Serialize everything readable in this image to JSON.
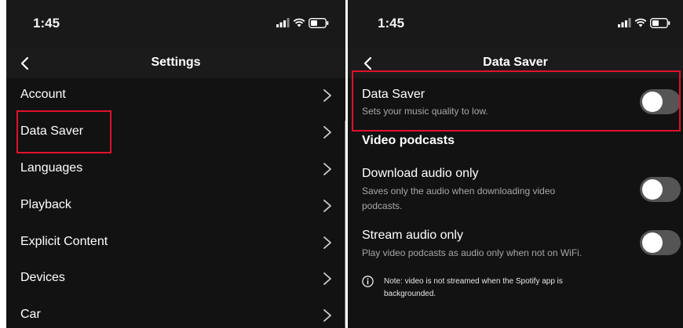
{
  "left_screen": {
    "status_time": "1:45",
    "nav_title": "Settings",
    "menu_items": [
      {
        "label": "Account"
      },
      {
        "label": "Data Saver"
      },
      {
        "label": "Languages"
      },
      {
        "label": "Playback"
      },
      {
        "label": "Explicit Content"
      },
      {
        "label": "Devices"
      },
      {
        "label": "Car"
      }
    ],
    "highlighted_item": "Data Saver"
  },
  "right_screen": {
    "status_time": "1:45",
    "nav_title": "Data Saver",
    "data_saver": {
      "title": "Data Saver",
      "description": "Sets your music quality to low.",
      "enabled": false
    },
    "section_heading": "Video podcasts",
    "download_audio": {
      "title": "Download audio only",
      "description_line1": "Saves only the audio when downloading video",
      "description_line2": "podcasts.",
      "enabled": false
    },
    "stream_audio": {
      "title": "Stream audio only",
      "description": "Play video podcasts as audio only when not on WiFi.",
      "enabled": false
    },
    "note_line1": "Note: video is not streamed when the Spotify app is",
    "note_line2": "backgrounded."
  },
  "icons": {
    "status": [
      "signal-icon",
      "wifi-icon",
      "battery-icon"
    ],
    "nav": "back-arrow-icon",
    "row": "chevron-right-icon",
    "note": "info-icon"
  },
  "colors": {
    "background": "#121212",
    "highlight": "#e0112b",
    "toggle_off": "#555555",
    "secondary_text": "#a7a7a7"
  }
}
